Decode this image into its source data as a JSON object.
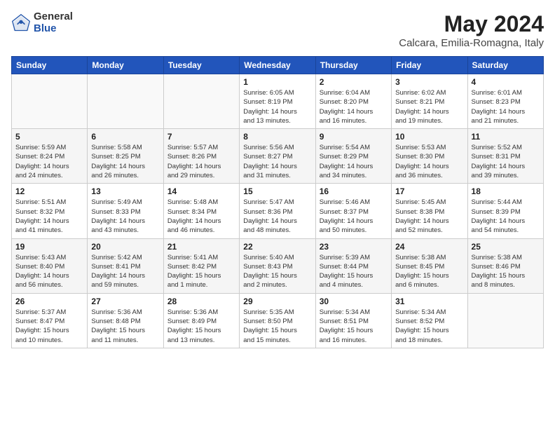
{
  "logo": {
    "general": "General",
    "blue": "Blue"
  },
  "title": {
    "month": "May 2024",
    "location": "Calcara, Emilia-Romagna, Italy"
  },
  "headers": [
    "Sunday",
    "Monday",
    "Tuesday",
    "Wednesday",
    "Thursday",
    "Friday",
    "Saturday"
  ],
  "weeks": [
    [
      {
        "day": "",
        "info": ""
      },
      {
        "day": "",
        "info": ""
      },
      {
        "day": "",
        "info": ""
      },
      {
        "day": "1",
        "info": "Sunrise: 6:05 AM\nSunset: 8:19 PM\nDaylight: 14 hours\nand 13 minutes."
      },
      {
        "day": "2",
        "info": "Sunrise: 6:04 AM\nSunset: 8:20 PM\nDaylight: 14 hours\nand 16 minutes."
      },
      {
        "day": "3",
        "info": "Sunrise: 6:02 AM\nSunset: 8:21 PM\nDaylight: 14 hours\nand 19 minutes."
      },
      {
        "day": "4",
        "info": "Sunrise: 6:01 AM\nSunset: 8:23 PM\nDaylight: 14 hours\nand 21 minutes."
      }
    ],
    [
      {
        "day": "5",
        "info": "Sunrise: 5:59 AM\nSunset: 8:24 PM\nDaylight: 14 hours\nand 24 minutes."
      },
      {
        "day": "6",
        "info": "Sunrise: 5:58 AM\nSunset: 8:25 PM\nDaylight: 14 hours\nand 26 minutes."
      },
      {
        "day": "7",
        "info": "Sunrise: 5:57 AM\nSunset: 8:26 PM\nDaylight: 14 hours\nand 29 minutes."
      },
      {
        "day": "8",
        "info": "Sunrise: 5:56 AM\nSunset: 8:27 PM\nDaylight: 14 hours\nand 31 minutes."
      },
      {
        "day": "9",
        "info": "Sunrise: 5:54 AM\nSunset: 8:29 PM\nDaylight: 14 hours\nand 34 minutes."
      },
      {
        "day": "10",
        "info": "Sunrise: 5:53 AM\nSunset: 8:30 PM\nDaylight: 14 hours\nand 36 minutes."
      },
      {
        "day": "11",
        "info": "Sunrise: 5:52 AM\nSunset: 8:31 PM\nDaylight: 14 hours\nand 39 minutes."
      }
    ],
    [
      {
        "day": "12",
        "info": "Sunrise: 5:51 AM\nSunset: 8:32 PM\nDaylight: 14 hours\nand 41 minutes."
      },
      {
        "day": "13",
        "info": "Sunrise: 5:49 AM\nSunset: 8:33 PM\nDaylight: 14 hours\nand 43 minutes."
      },
      {
        "day": "14",
        "info": "Sunrise: 5:48 AM\nSunset: 8:34 PM\nDaylight: 14 hours\nand 46 minutes."
      },
      {
        "day": "15",
        "info": "Sunrise: 5:47 AM\nSunset: 8:36 PM\nDaylight: 14 hours\nand 48 minutes."
      },
      {
        "day": "16",
        "info": "Sunrise: 5:46 AM\nSunset: 8:37 PM\nDaylight: 14 hours\nand 50 minutes."
      },
      {
        "day": "17",
        "info": "Sunrise: 5:45 AM\nSunset: 8:38 PM\nDaylight: 14 hours\nand 52 minutes."
      },
      {
        "day": "18",
        "info": "Sunrise: 5:44 AM\nSunset: 8:39 PM\nDaylight: 14 hours\nand 54 minutes."
      }
    ],
    [
      {
        "day": "19",
        "info": "Sunrise: 5:43 AM\nSunset: 8:40 PM\nDaylight: 14 hours\nand 56 minutes."
      },
      {
        "day": "20",
        "info": "Sunrise: 5:42 AM\nSunset: 8:41 PM\nDaylight: 14 hours\nand 59 minutes."
      },
      {
        "day": "21",
        "info": "Sunrise: 5:41 AM\nSunset: 8:42 PM\nDaylight: 15 hours\nand 1 minute."
      },
      {
        "day": "22",
        "info": "Sunrise: 5:40 AM\nSunset: 8:43 PM\nDaylight: 15 hours\nand 2 minutes."
      },
      {
        "day": "23",
        "info": "Sunrise: 5:39 AM\nSunset: 8:44 PM\nDaylight: 15 hours\nand 4 minutes."
      },
      {
        "day": "24",
        "info": "Sunrise: 5:38 AM\nSunset: 8:45 PM\nDaylight: 15 hours\nand 6 minutes."
      },
      {
        "day": "25",
        "info": "Sunrise: 5:38 AM\nSunset: 8:46 PM\nDaylight: 15 hours\nand 8 minutes."
      }
    ],
    [
      {
        "day": "26",
        "info": "Sunrise: 5:37 AM\nSunset: 8:47 PM\nDaylight: 15 hours\nand 10 minutes."
      },
      {
        "day": "27",
        "info": "Sunrise: 5:36 AM\nSunset: 8:48 PM\nDaylight: 15 hours\nand 11 minutes."
      },
      {
        "day": "28",
        "info": "Sunrise: 5:36 AM\nSunset: 8:49 PM\nDaylight: 15 hours\nand 13 minutes."
      },
      {
        "day": "29",
        "info": "Sunrise: 5:35 AM\nSunset: 8:50 PM\nDaylight: 15 hours\nand 15 minutes."
      },
      {
        "day": "30",
        "info": "Sunrise: 5:34 AM\nSunset: 8:51 PM\nDaylight: 15 hours\nand 16 minutes."
      },
      {
        "day": "31",
        "info": "Sunrise: 5:34 AM\nSunset: 8:52 PM\nDaylight: 15 hours\nand 18 minutes."
      },
      {
        "day": "",
        "info": ""
      }
    ]
  ]
}
